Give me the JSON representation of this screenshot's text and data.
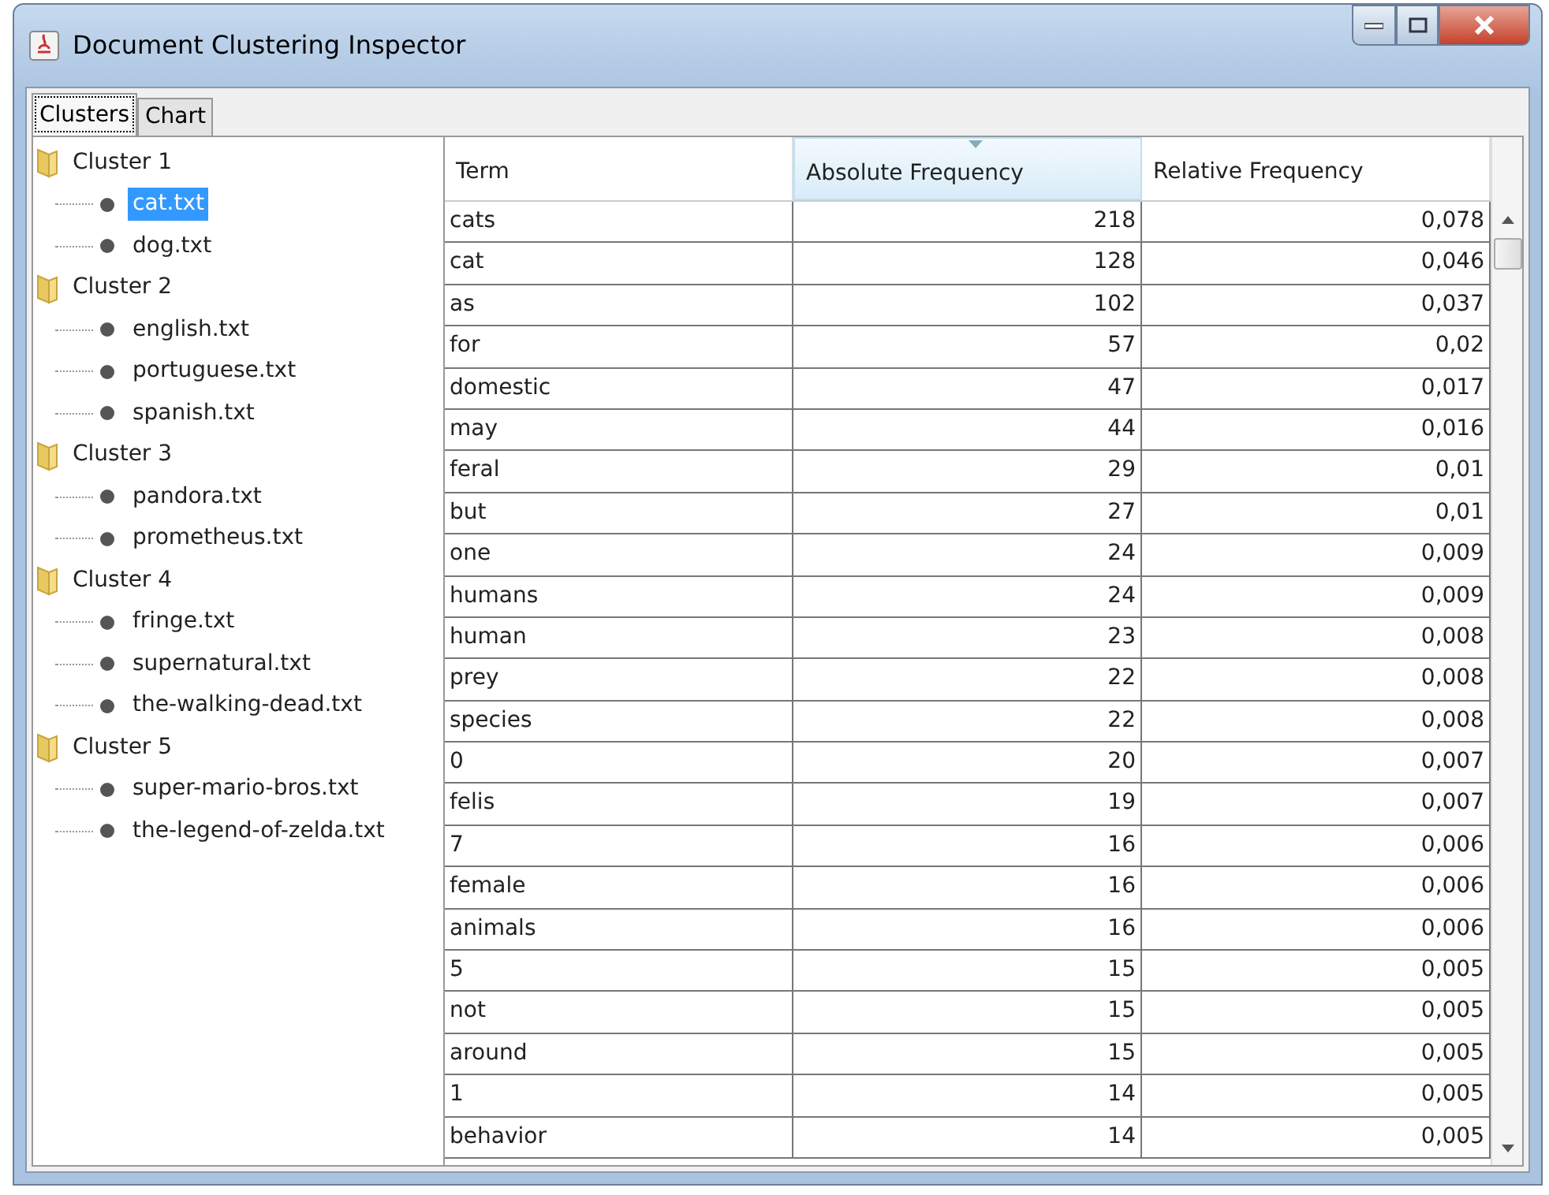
{
  "window": {
    "title": "Document Clustering Inspector"
  },
  "tabs": [
    {
      "label": "Clusters",
      "selected": true
    },
    {
      "label": "Chart",
      "selected": false
    }
  ],
  "tree": [
    {
      "label": "Cluster 1",
      "children": [
        {
          "label": "cat.txt",
          "selected": true
        },
        {
          "label": "dog.txt",
          "selected": false
        }
      ]
    },
    {
      "label": "Cluster 2",
      "children": [
        {
          "label": "english.txt",
          "selected": false
        },
        {
          "label": "portuguese.txt",
          "selected": false
        },
        {
          "label": "spanish.txt",
          "selected": false
        }
      ]
    },
    {
      "label": "Cluster 3",
      "children": [
        {
          "label": "pandora.txt",
          "selected": false
        },
        {
          "label": "prometheus.txt",
          "selected": false
        }
      ]
    },
    {
      "label": "Cluster 4",
      "children": [
        {
          "label": "fringe.txt",
          "selected": false
        },
        {
          "label": "supernatural.txt",
          "selected": false
        },
        {
          "label": "the-walking-dead.txt",
          "selected": false
        }
      ]
    },
    {
      "label": "Cluster 5",
      "children": [
        {
          "label": "super-mario-bros.txt",
          "selected": false
        },
        {
          "label": "the-legend-of-zelda.txt",
          "selected": false
        }
      ]
    }
  ],
  "table": {
    "columns": [
      {
        "label": "Term",
        "sorted": false
      },
      {
        "label": "Absolute Frequency",
        "sorted": true
      },
      {
        "label": "Relative Frequency",
        "sorted": false
      }
    ],
    "rows": [
      [
        "cats",
        "218",
        "0,078"
      ],
      [
        "cat",
        "128",
        "0,046"
      ],
      [
        "as",
        "102",
        "0,037"
      ],
      [
        "for",
        "57",
        "0,02"
      ],
      [
        "domestic",
        "47",
        "0,017"
      ],
      [
        "may",
        "44",
        "0,016"
      ],
      [
        "feral",
        "29",
        "0,01"
      ],
      [
        "but",
        "27",
        "0,01"
      ],
      [
        "one",
        "24",
        "0,009"
      ],
      [
        "humans",
        "24",
        "0,009"
      ],
      [
        "human",
        "23",
        "0,008"
      ],
      [
        "prey",
        "22",
        "0,008"
      ],
      [
        "species",
        "22",
        "0,008"
      ],
      [
        "0",
        "20",
        "0,007"
      ],
      [
        "felis",
        "19",
        "0,007"
      ],
      [
        "7",
        "16",
        "0,006"
      ],
      [
        "female",
        "16",
        "0,006"
      ],
      [
        "animals",
        "16",
        "0,006"
      ],
      [
        "5",
        "15",
        "0,005"
      ],
      [
        "not",
        "15",
        "0,005"
      ],
      [
        "around",
        "15",
        "0,005"
      ],
      [
        "1",
        "14",
        "0,005"
      ],
      [
        "behavior",
        "14",
        "0,005"
      ]
    ]
  }
}
